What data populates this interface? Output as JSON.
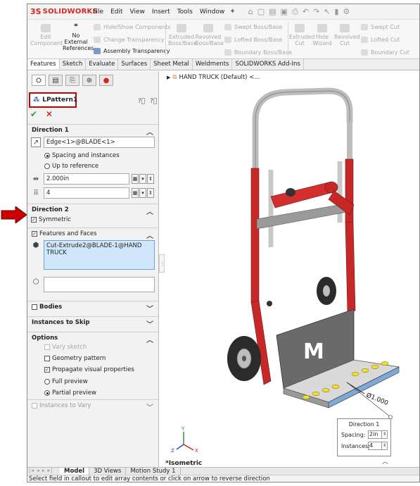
{
  "app": {
    "logo_ds": "3S",
    "logo_name": "SOLIDWORKS",
    "menus": [
      "File",
      "Edit",
      "View",
      "Insert",
      "Tools",
      "Window"
    ]
  },
  "ribbon": {
    "edit_component": "Edit Component",
    "no_external_refs": "No External References",
    "hide_show": "Hide/Show Components",
    "change_transparency": "Change Transparency",
    "assembly_transparency": "Assembly Transparency",
    "extruded_boss": "Extruded Boss/Base",
    "revolved_boss": "Revolved Boss/Base",
    "swept_boss": "Swept Boss/Base",
    "lofted_boss": "Lofted Boss/Base",
    "boundary_boss": "Boundary Boss/Base",
    "extruded_cut": "Extruded Cut",
    "hole_wizard": "Hole Wizard",
    "revolved_cut": "Revolved Cut",
    "swept_cut": "Swept Cut",
    "lofted_cut": "Lofted Cut",
    "boundary_cut": "Boundary Cut"
  },
  "tabs": [
    "Features",
    "Sketch",
    "Evaluate",
    "Surfaces",
    "Sheet Metal",
    "Weldments",
    "SOLIDWORKS Add-Ins"
  ],
  "panel": {
    "title": "LPattern1",
    "direction1": {
      "header": "Direction 1",
      "edge": "Edge<1>@BLADE<1>",
      "spacing_instances": "Spacing and instances",
      "up_to_reference": "Up to reference",
      "spacing": "2.000in",
      "instances": "4"
    },
    "direction2": {
      "header": "Direction 2",
      "symmetric": "Symmetric"
    },
    "features": {
      "header": "Features and Faces",
      "list_item": "Cut-Extrude2@BLADE-1@HAND TRUCK"
    },
    "bodies": "Bodies",
    "instances_to_skip": "Instances to Skip",
    "options": {
      "header": "Options",
      "vary_sketch": "Vary sketch",
      "geometry_pattern": "Geometry pattern",
      "propagate": "Propagate visual properties",
      "full_preview": "Full preview",
      "partial_preview": "Partial preview"
    },
    "instances_to_vary": "Instances to Vary"
  },
  "viewport": {
    "tree_label": "HAND TRUCK (Default) <...",
    "view_name": "*Isometric",
    "dimension": "Ø1.000",
    "logo_letter": "M",
    "callout": {
      "title": "Direction 1",
      "spacing_label": "Spacing:",
      "spacing_value": "2in",
      "instances_label": "Instances:",
      "instances_value": "4"
    },
    "triad": {
      "x": "X",
      "y": "Y",
      "z": "Z"
    }
  },
  "bottom_tabs": [
    "Model",
    "3D Views",
    "Motion Study 1"
  ],
  "status": "Select field in callout to edit array contents or click on arrow to reverse direction",
  "colors": {
    "red": "#d7261e",
    "frame_red": "#c62828",
    "selection_blue": "#cfe6fb"
  }
}
